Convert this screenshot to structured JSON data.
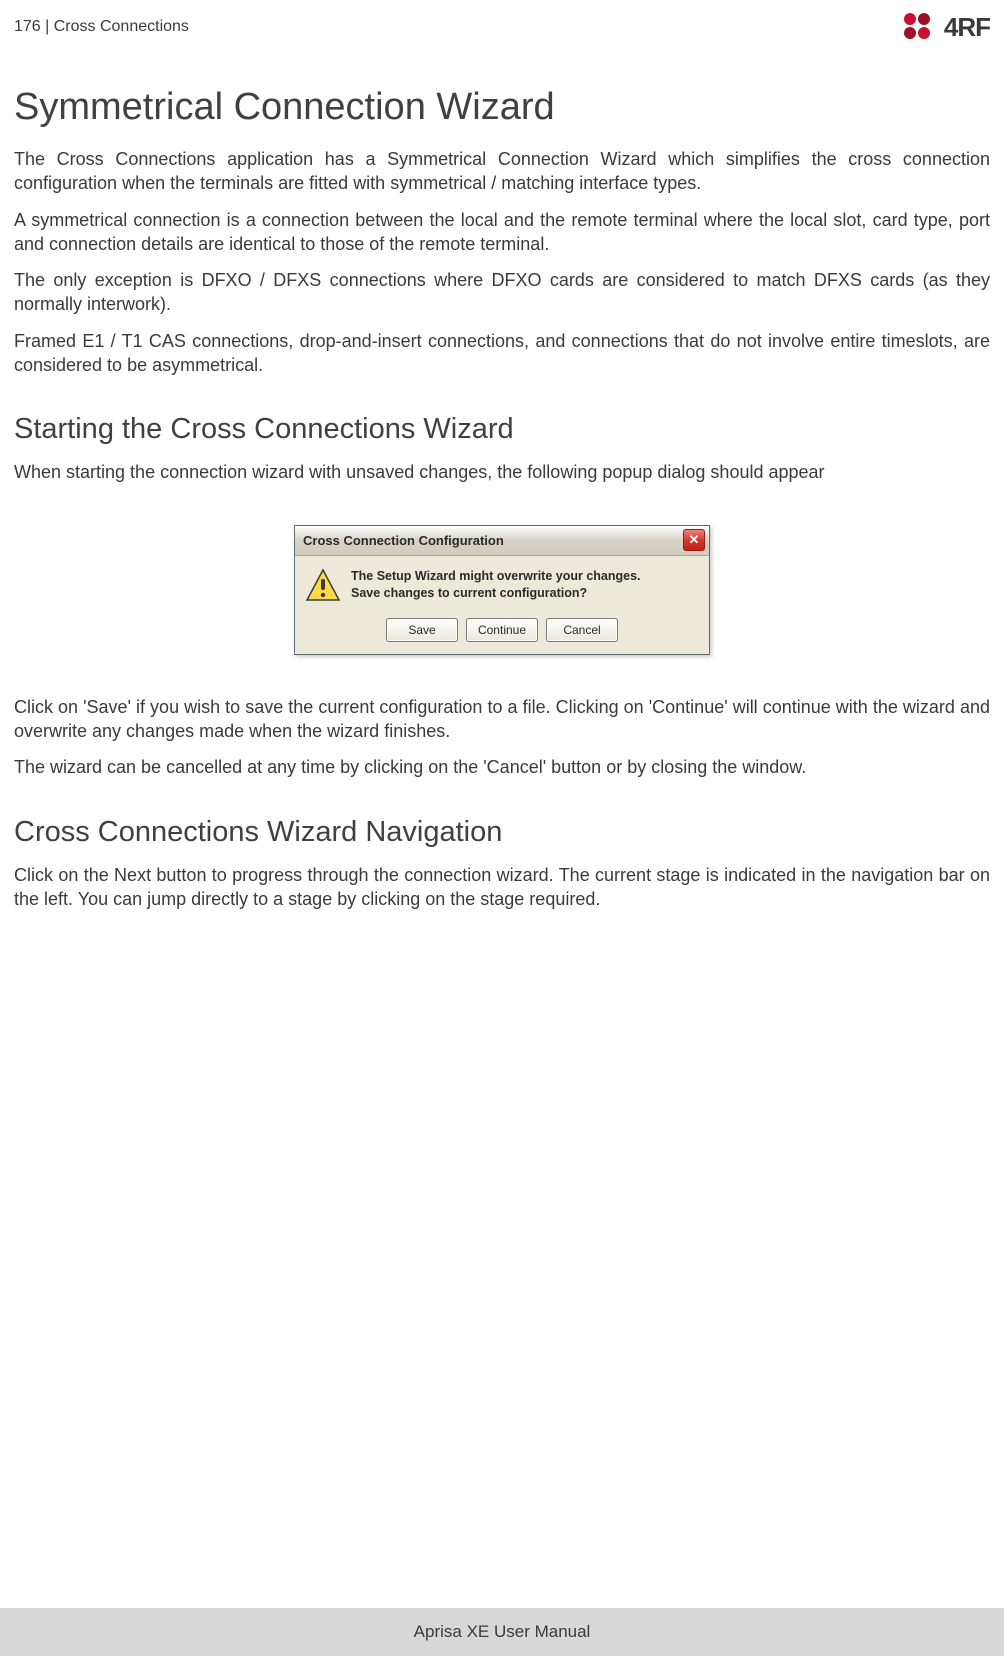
{
  "header": {
    "page_number_section": "176  |  Cross Connections",
    "brand_text": "4RF"
  },
  "h1": "Symmetrical Connection Wizard",
  "p1": "The Cross Connections application has a Symmetrical Connection Wizard which simplifies the cross connection configuration when the terminals are fitted with symmetrical / matching interface types.",
  "p2": "A symmetrical connection is a connection between the local and the remote terminal where the local slot, card type, port and connection details are identical to those of the remote terminal.",
  "p3": "The only exception is DFXO / DFXS connections where DFXO cards are considered to match DFXS cards (as they normally interwork).",
  "p4": "Framed E1 / T1 CAS connections, drop-and-insert connections, and connections that do not involve entire timeslots, are considered to be asymmetrical.",
  "h2a": "Starting the Cross Connections Wizard",
  "p5": "When starting the connection wizard with unsaved changes, the following popup dialog should appear",
  "dialog": {
    "title": "Cross Connection Configuration",
    "line1": "The Setup Wizard might overwrite your changes.",
    "line2": "Save changes to current configuration?",
    "save": "Save",
    "continue": "Continue",
    "cancel": "Cancel",
    "close": "✕"
  },
  "p6": "Click on 'Save' if you wish to save the current configuration to a file. Clicking on 'Continue' will continue with the wizard and overwrite any changes made when the wizard finishes.",
  "p7": "The wizard can be cancelled at any time by clicking on the 'Cancel' button or by closing the window.",
  "h2b": "Cross Connections Wizard Navigation",
  "p8": "Click on the Next button to progress through the connection wizard. The current stage is indicated in the navigation bar on the left. You can jump directly to a stage by clicking on the stage required.",
  "footer": "Aprisa XE User Manual"
}
